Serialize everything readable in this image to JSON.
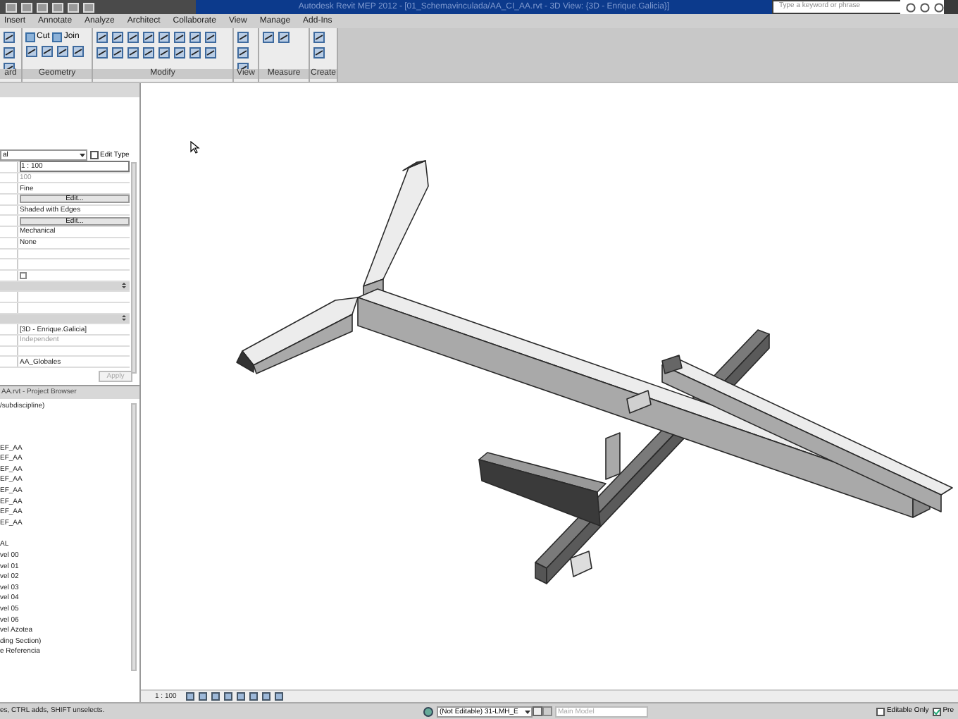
{
  "title_bar": {
    "title": "Autodesk Revit MEP 2012 - [01_Schemavinculada/AA_CI_AA.rvt - 3D View: {3D - Enrique.Galicia}]",
    "search_placeholder": "Type a keyword or phrase"
  },
  "ribbon": {
    "tabs": [
      {
        "label": "Insert",
        "selected": false
      },
      {
        "label": "Annotate",
        "selected": false
      },
      {
        "label": "Analyze",
        "selected": false
      },
      {
        "label": "Architect",
        "selected": false
      },
      {
        "label": "Collaborate",
        "selected": false
      },
      {
        "label": "View",
        "selected": false
      },
      {
        "label": "Manage",
        "selected": false
      },
      {
        "label": "Add-Ins",
        "selected": false
      }
    ],
    "panels": [
      {
        "label": "ard"
      },
      {
        "label": "Geometry",
        "tools": [
          "Cut",
          "Join"
        ]
      },
      {
        "label": "Modify"
      },
      {
        "label": "View"
      },
      {
        "label": "Measure"
      },
      {
        "label": "Create"
      }
    ]
  },
  "properties": {
    "type_selector": "al",
    "edit_type": "Edit Type",
    "rows": [
      {
        "kind": "value",
        "value": "1 : 100",
        "disabled": false,
        "boxed": true
      },
      {
        "kind": "value",
        "value": "100",
        "disabled": true,
        "boxed": false
      },
      {
        "kind": "value",
        "value": "Fine",
        "disabled": false,
        "boxed": false
      },
      {
        "kind": "button",
        "value": "Edit..."
      },
      {
        "kind": "value",
        "value": "Shaded with Edges",
        "disabled": false,
        "boxed": false
      },
      {
        "kind": "button",
        "value": "Edit..."
      },
      {
        "kind": "value",
        "value": "Mechanical",
        "disabled": false,
        "boxed": false
      },
      {
        "kind": "value",
        "value": "None",
        "disabled": false,
        "boxed": false
      },
      {
        "kind": "empty"
      },
      {
        "kind": "empty"
      },
      {
        "kind": "checkbox",
        "checked": false
      },
      {
        "kind": "header"
      },
      {
        "kind": "empty"
      },
      {
        "kind": "empty"
      },
      {
        "kind": "header"
      },
      {
        "kind": "value",
        "value": "[3D - Enrique.Galicia]",
        "disabled": false,
        "boxed": false
      },
      {
        "kind": "value",
        "value": "Independent",
        "disabled": true,
        "boxed": false
      },
      {
        "kind": "empty"
      },
      {
        "kind": "value",
        "value": "AA_Globales",
        "disabled": false,
        "boxed": false
      }
    ],
    "apply": {
      "label": "Apply",
      "disabled": true
    }
  },
  "project_browser": {
    "title": "AA.rvt - Project Browser",
    "groups": [
      {
        "items": [
          "/subdiscipline)"
        ]
      },
      {
        "items": [
          "EF_AA",
          "EF_AA",
          "EF_AA",
          "EF_AA",
          "EF_AA",
          "EF_AA",
          "EF_AA",
          "EF_AA"
        ]
      },
      {
        "items": [
          "AL",
          "vel 00",
          "vel 01",
          "vel 02",
          "vel 03",
          "vel 04",
          "vel 05",
          "vel 06",
          "vel Azotea",
          "ding Section)",
          "e Referencia"
        ]
      }
    ]
  },
  "view_control_bar": {
    "scale": "1 : 100"
  },
  "status_bar": {
    "message": "es, CTRL adds, SHIFT unselects.",
    "workset": "(Not Editable) 31-LMH_E",
    "design_option": "Main Model",
    "editable_only": {
      "label": "Editable Only",
      "checked": false
    },
    "press_drag": {
      "label": "Pre",
      "checked": true
    }
  }
}
